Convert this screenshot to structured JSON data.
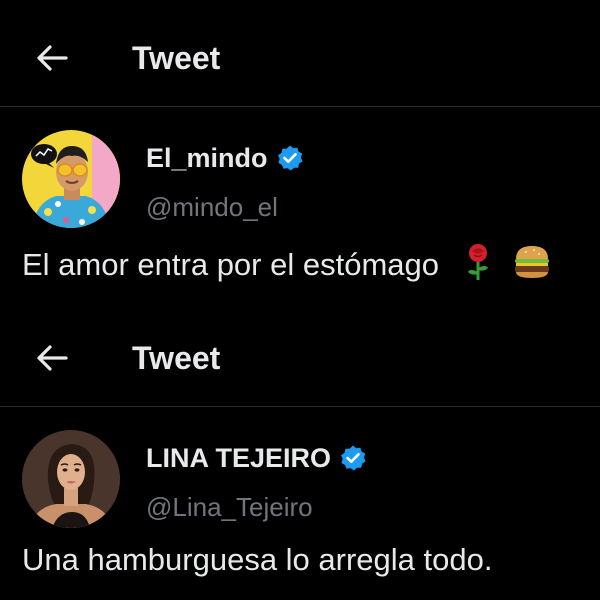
{
  "tweet1": {
    "header_title": "Tweet",
    "author_name": "El_mindo",
    "author_handle": "@mindo_el",
    "text": "El amor entra por el estómago",
    "emojis": [
      "rose",
      "hamburger"
    ]
  },
  "tweet2": {
    "header_title": "Tweet",
    "author_name": "LINA TEJEIRO",
    "author_handle": "@Lina_Tejeiro",
    "text": "Una hamburguesa lo arregla todo."
  },
  "colors": {
    "background": "#000000",
    "text_primary": "#e7e9ea",
    "text_secondary": "#71767b",
    "verified_blue": "#1d9bf0",
    "divider": "#2a2d30"
  },
  "icons": {
    "back": "arrow-left-icon",
    "verified": "verified-badge-icon"
  }
}
